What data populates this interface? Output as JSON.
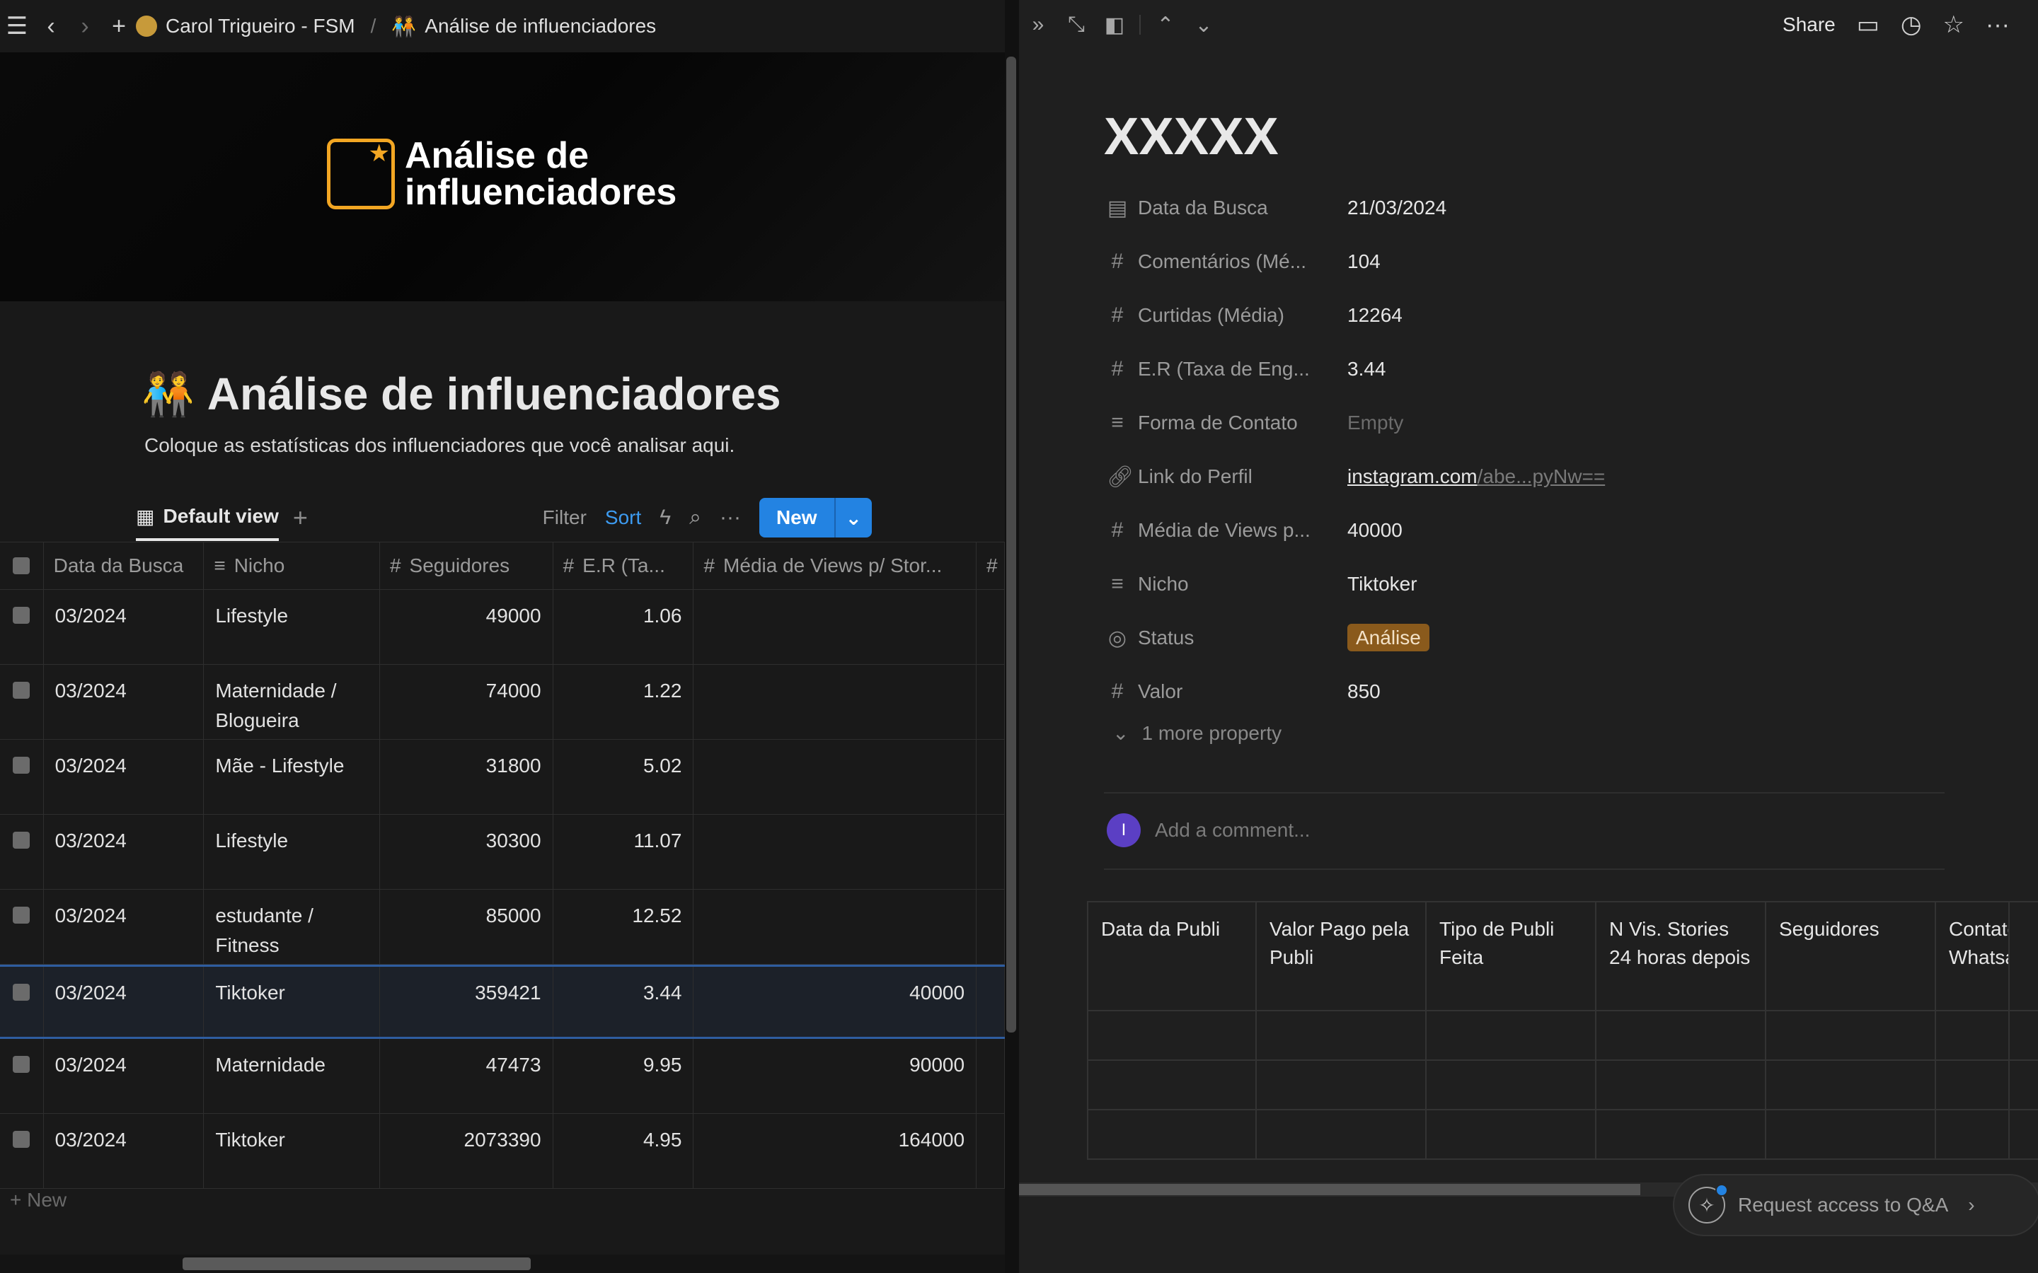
{
  "breadcrumb": {
    "workspace": "Carol Trigueiro - FSM",
    "page": "Análise de influenciadores"
  },
  "cover": {
    "line1": "Análise de",
    "line2": "influenciadores"
  },
  "page": {
    "title": "Análise de influenciadores",
    "description": "Coloque as estatísticas dos influenciadores que você analisar aqui."
  },
  "viewbar": {
    "view_label": "Default view",
    "filter": "Filter",
    "sort": "Sort",
    "new": "New"
  },
  "table": {
    "columns": [
      "Data da Busca",
      "Nicho",
      "Seguidores",
      "E.R (Ta...",
      "Média de Views p/ Stor..."
    ],
    "rows": [
      {
        "date": "03/2024",
        "nicho": "Lifestyle",
        "seguidores": "49000",
        "er": "1.06",
        "views": ""
      },
      {
        "date": "03/2024",
        "nicho": "Maternidade / Blogueira",
        "seguidores": "74000",
        "er": "1.22",
        "views": ""
      },
      {
        "date": "03/2024",
        "nicho": "Mãe - Lifestyle",
        "seguidores": "31800",
        "er": "5.02",
        "views": ""
      },
      {
        "date": "03/2024",
        "nicho": "Lifestyle",
        "seguidores": "30300",
        "er": "11.07",
        "views": ""
      },
      {
        "date": "03/2024",
        "nicho": "estudante / Fitness",
        "seguidores": "85000",
        "er": "12.52",
        "views": ""
      },
      {
        "date": "03/2024",
        "nicho": "Tiktoker",
        "seguidores": "359421",
        "er": "3.44",
        "views": "40000"
      },
      {
        "date": "03/2024",
        "nicho": "Maternidade",
        "seguidores": "47473",
        "er": "9.95",
        "views": "90000"
      },
      {
        "date": "03/2024",
        "nicho": "Tiktoker",
        "seguidores": "2073390",
        "er": "4.95",
        "views": "164000"
      }
    ],
    "new_row": "New"
  },
  "detail": {
    "share": "Share",
    "title": "XXXXX",
    "props": {
      "data_busca": {
        "name": "Data da Busca",
        "value": "21/03/2024"
      },
      "comentarios": {
        "name": "Comentários (Mé...",
        "value": "104"
      },
      "curtidas": {
        "name": "Curtidas (Média)",
        "value": "12264"
      },
      "er": {
        "name": "E.R (Taxa de Eng...",
        "value": "3.44"
      },
      "forma": {
        "name": "Forma de Contato",
        "value": "Empty"
      },
      "link": {
        "name": "Link do Perfil",
        "value_main": "instagram.com",
        "value_rest": "/abe...pyNw=="
      },
      "media": {
        "name": "Média de Views p...",
        "value": "40000"
      },
      "nicho": {
        "name": "Nicho",
        "value": "Tiktoker"
      },
      "status": {
        "name": "Status",
        "value": "Análise"
      },
      "valor": {
        "name": "Valor",
        "value": "850"
      }
    },
    "more": "1 more property",
    "avatar_letter": "I",
    "comment_placeholder": "Add a comment...",
    "inner_columns": [
      "Data da Publi",
      "Valor Pago pela Publi",
      "Tipo de Publi Feita",
      "N Vis. Stories 24 horas depois",
      "Seguidores",
      "Contato Whatsa"
    ],
    "qa": "Request access to Q&A"
  },
  "colors": {
    "accent": "#2383e2",
    "status_badge": "#8a5a1c",
    "logo": "#f2a623"
  }
}
